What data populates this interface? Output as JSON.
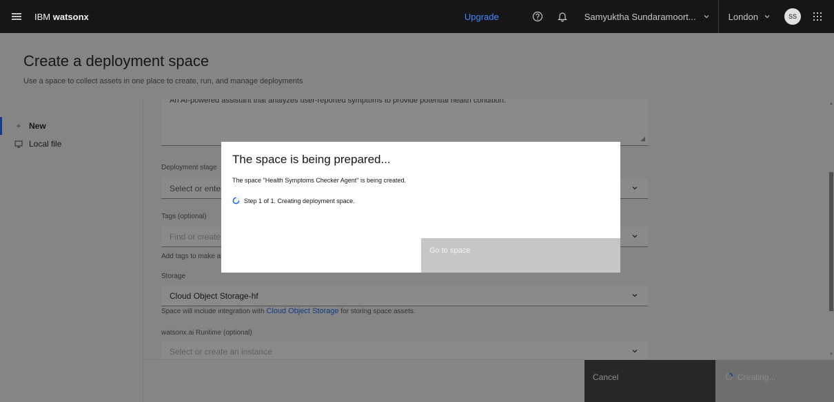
{
  "topbar": {
    "brand_prefix": "IBM",
    "brand_name": "watsonx",
    "upgrade": "Upgrade",
    "user_name": "Samyuktha Sundaramoort...",
    "region": "London",
    "avatar_initials": "SS"
  },
  "header": {
    "title": "Create a deployment space",
    "subtitle": "Use a space to collect assets in one place to create, run, and manage deployments"
  },
  "nav": {
    "items": [
      {
        "label": "New",
        "icon": "plus-icon"
      },
      {
        "label": "Local file",
        "icon": "computer-icon"
      }
    ]
  },
  "form": {
    "description_value": "An AI-powered assistant that analyzes user-reported symptoms to provide potential health condition.",
    "deployment_stage_label": "Deployment stage",
    "deployment_stage_placeholder": "Select or enter",
    "tags_label": "Tags (optional)",
    "tags_placeholder": "Find or create",
    "tags_helper": "Add tags to make as",
    "storage_label": "Storage",
    "storage_value": "Cloud Object Storage-hf",
    "storage_helper_prefix": "Space will include integration with",
    "storage_helper_link": "Cloud Object Storage",
    "storage_helper_suffix": "for storing space assets.",
    "runtime_label": "watsonx.ai Runtime (optional)",
    "runtime_placeholder": "Select or create an instance"
  },
  "footer": {
    "cancel": "Cancel",
    "creating": "Creating..."
  },
  "modal": {
    "title": "The space is being prepared...",
    "text": "The space \"Health Symptoms Checker Agent\" is being created.",
    "step": "Step 1 of 1. Creating deployment space.",
    "go_button": "Go to space"
  },
  "colors": {
    "topbar_bg": "#161616",
    "accent": "#0f62fe",
    "upgrade": "#4589ff"
  }
}
